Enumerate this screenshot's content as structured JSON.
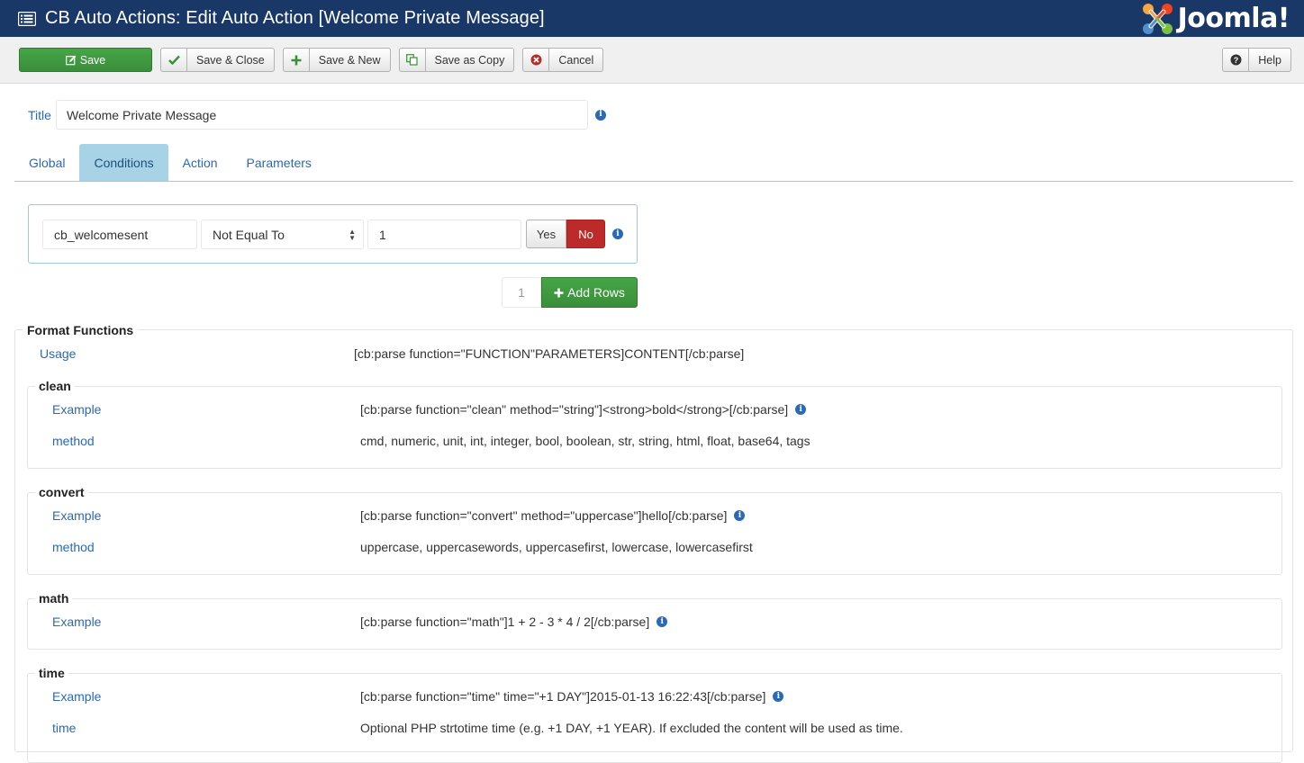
{
  "header": {
    "title": "CB Auto Actions: Edit Auto Action [Welcome Private Message]",
    "logo_text": "Joomla!",
    "icons": {
      "page": "list-icon",
      "logo": "joomla-logo-icon"
    }
  },
  "toolbar": {
    "save": "Save",
    "save_close": "Save & Close",
    "save_new": "Save & New",
    "save_copy": "Save as Copy",
    "cancel": "Cancel",
    "help": "Help"
  },
  "form": {
    "title_label": "Title",
    "title_value": "Welcome Private Message"
  },
  "tabs": [
    {
      "label": "Global"
    },
    {
      "label": "Conditions",
      "active": true
    },
    {
      "label": "Action"
    },
    {
      "label": "Parameters"
    }
  ],
  "condition": {
    "field": "cb_welcomesent",
    "operator": "Not Equal To",
    "value": "1",
    "yes": "Yes",
    "no": "No",
    "selected": "No"
  },
  "add_rows": {
    "count": "1",
    "label": "Add Rows"
  },
  "format_functions": {
    "legend": "Format Functions",
    "usage_label": "Usage",
    "usage_value": "[cb:parse function=\"FUNCTION\"PARAMETERS]CONTENT[/cb:parse]",
    "groups": [
      {
        "name": "clean",
        "rows": [
          {
            "key": "Example",
            "value": "[cb:parse function=\"clean\" method=\"string\"]<strong>bold</strong>[/cb:parse]",
            "info": true
          },
          {
            "key": "method",
            "value": "cmd, numeric, unit, int, integer, bool, boolean, str, string, html, float, base64, tags"
          }
        ]
      },
      {
        "name": "convert",
        "rows": [
          {
            "key": "Example",
            "value": "[cb:parse function=\"convert\" method=\"uppercase\"]hello[/cb:parse]",
            "info": true
          },
          {
            "key": "method",
            "value": "uppercase, uppercasewords, uppercasefirst, lowercase, lowercasefirst"
          }
        ]
      },
      {
        "name": "math",
        "rows": [
          {
            "key": "Example",
            "value": "[cb:parse function=\"math\"]1 + 2 - 3 * 4 / 2[/cb:parse]",
            "info": true
          }
        ]
      },
      {
        "name": "time",
        "rows": [
          {
            "key": "Example",
            "value": "[cb:parse function=\"time\" time=\"+1 DAY\"]2015-01-13 16:22:43[/cb:parse]",
            "info": true
          },
          {
            "key": "time",
            "value": "Optional PHP strtotime time (e.g. +1 DAY, +1 YEAR). If excluded the content will be used as time."
          }
        ]
      }
    ]
  },
  "colors": {
    "header_bg": "#1a3867",
    "save_green": "#46a546",
    "no_red": "#bd2a2a",
    "link_blue": "#2a69b8",
    "active_tab": "#a8d3e6"
  }
}
